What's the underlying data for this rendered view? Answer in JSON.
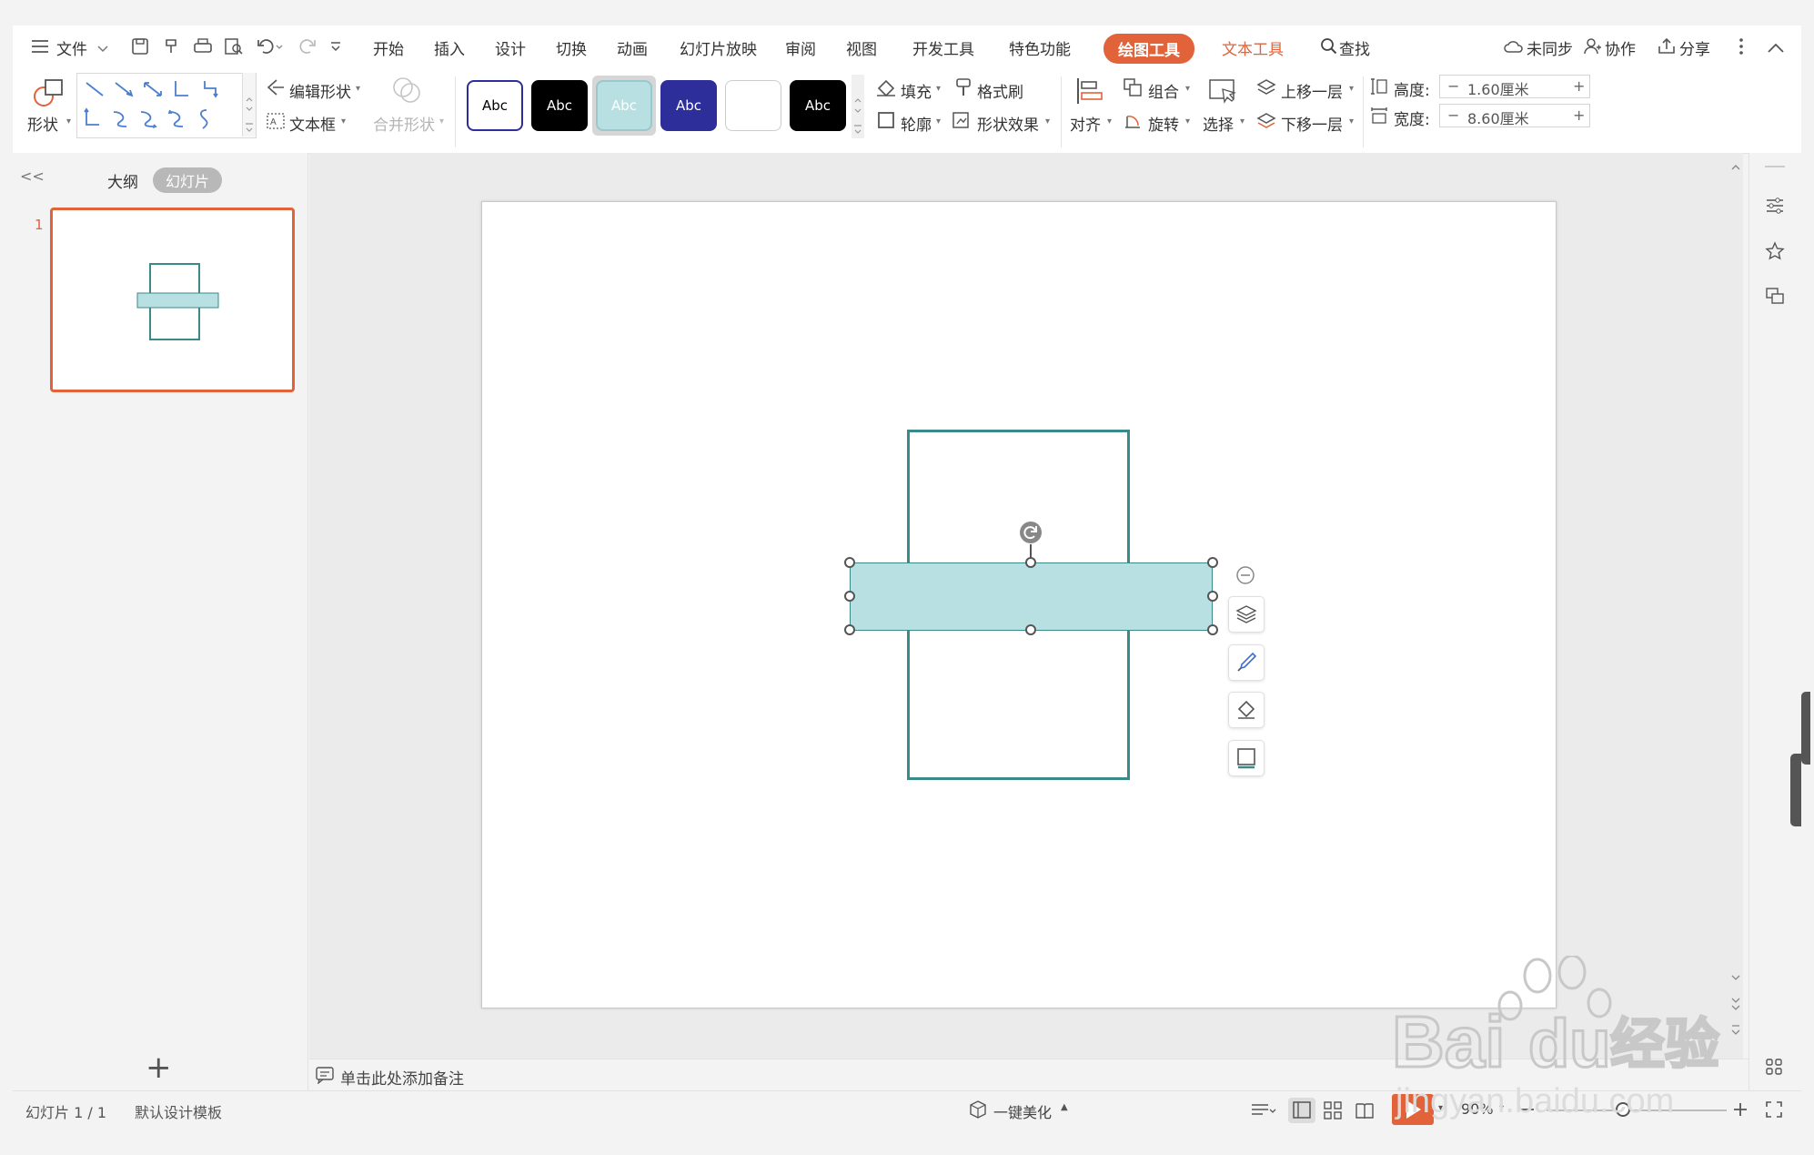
{
  "menu": {
    "file": "文件",
    "tabs": [
      "开始",
      "插入",
      "设计",
      "切换",
      "动画",
      "幻灯片放映",
      "审阅",
      "视图",
      "开发工具",
      "特色功能"
    ],
    "drawing_tools": "绘图工具",
    "text_tools": "文本工具",
    "search": "查找",
    "unsynced": "未同步",
    "collaborate": "协作",
    "share": "分享"
  },
  "ribbon": {
    "shape": "形状",
    "edit_shape": "编辑形状",
    "text_box": "文本框",
    "merge_shapes": "合并形状",
    "style_sample": "Abc",
    "fill": "填充",
    "format_painter": "格式刷",
    "outline": "轮廓",
    "shape_effects": "形状效果",
    "align": "对齐",
    "group": "组合",
    "rotate": "旋转",
    "select": "选择",
    "bring_forward": "上移一层",
    "send_backward": "下移一层",
    "height_label": "高度:",
    "height_value": "1.60厘米",
    "width_label": "宽度:",
    "width_value": "8.60厘米",
    "minus": "−",
    "plus": "+"
  },
  "left_pane": {
    "collapse": "<<",
    "outline_tab": "大纲",
    "slides_tab": "幻灯片",
    "slide_number": "1",
    "add": "+"
  },
  "notes": {
    "placeholder": "单击此处添加备注"
  },
  "status": {
    "slide_count": "幻灯片 1 / 1",
    "template": "默认设计模板",
    "beautify": "一键美化",
    "zoom": "90%"
  },
  "colors": {
    "accent": "#e2623a",
    "shape_outline": "#3a8a8a",
    "shape_fill": "#b8dfe2",
    "style_navy": "#2e2e9a",
    "style_teal": "#b8dfe2"
  },
  "watermark": "Baidu经验 jingyan.baidu.com"
}
